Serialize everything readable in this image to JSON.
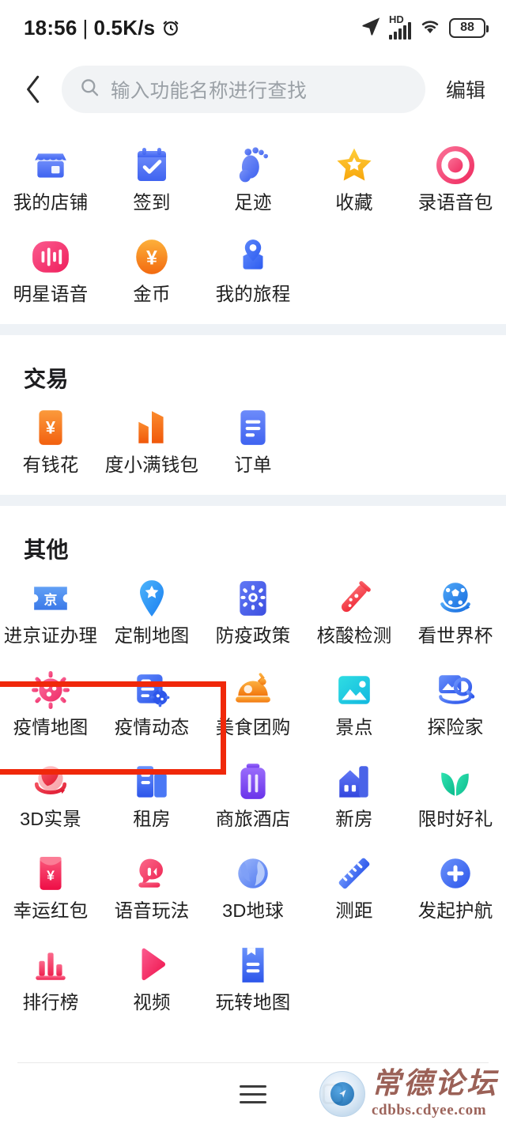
{
  "status_bar": {
    "time": "18:56",
    "separator": "|",
    "net_speed": "0.5K/s",
    "alarm_icon": "alarm-clock-icon",
    "location_icon": "location-arrow-icon",
    "hd_label": "HD",
    "signal_icon": "cellular-signal-icon",
    "wifi_icon": "wifi-icon",
    "battery_level": "88"
  },
  "header": {
    "back_icon": "chevron-left-icon",
    "search_placeholder": "输入功能名称进行查找",
    "search_value": "",
    "search_icon": "search-icon",
    "edit_label": "编辑"
  },
  "sections": [
    {
      "title": "",
      "items": [
        {
          "label": "我的店铺",
          "icon": "shop-icon",
          "color": "#5a7cf8"
        },
        {
          "label": "签到",
          "icon": "calendar-check-icon",
          "color": "#4c6ef5"
        },
        {
          "label": "足迹",
          "icon": "footprint-icon",
          "color": "#6d83f2"
        },
        {
          "label": "收藏",
          "icon": "star-icon",
          "color": "#fbb216"
        },
        {
          "label": "录语音包",
          "icon": "record-target-icon",
          "color": "#f2547d"
        },
        {
          "label": "明星语音",
          "icon": "voice-wave-icon",
          "color": "#f2376b"
        },
        {
          "label": "金币",
          "icon": "coin-yuan-icon",
          "color": "#f58220"
        },
        {
          "label": "我的旅程",
          "icon": "route-pin-icon",
          "color": "#3d72f7"
        }
      ]
    },
    {
      "title": "交易",
      "items": [
        {
          "label": "有钱花",
          "icon": "yuan-card-icon",
          "color": "#f5752a"
        },
        {
          "label": "度小满钱包",
          "icon": "wallet-icon",
          "color": "#f4701f"
        },
        {
          "label": "订单",
          "icon": "order-list-icon",
          "color": "#4c6ef5"
        }
      ]
    },
    {
      "title": "其他",
      "items": [
        {
          "label": "进京证办理",
          "icon": "jing-permit-icon",
          "color": "#4a8df0"
        },
        {
          "label": "定制地图",
          "icon": "map-pin-star-icon",
          "color": "#2e9bf5"
        },
        {
          "label": "防疫政策",
          "icon": "policy-gear-icon",
          "color": "#4a63e8"
        },
        {
          "label": "核酸检测",
          "icon": "test-tube-icon",
          "color": "#f2454c"
        },
        {
          "label": "看世界杯",
          "icon": "soccer-ball-icon",
          "color": "#2c8ef0"
        },
        {
          "label": "疫情地图",
          "icon": "virus-icon",
          "color": "#f2467a"
        },
        {
          "label": "疫情动态",
          "icon": "virus-report-icon",
          "color": "#3d6ef0"
        },
        {
          "label": "美食团购",
          "icon": "food-dome-icon",
          "color": "#f7931a"
        },
        {
          "label": "景点",
          "icon": "photo-mountain-icon",
          "color": "#1fc8dd"
        },
        {
          "label": "探险家",
          "icon": "explore-photo-search-icon",
          "color": "#3d72f7"
        },
        {
          "label": "3D实景",
          "icon": "3d-panorama-globe-icon",
          "color": "#ef3b4e"
        },
        {
          "label": "租房",
          "icon": "building-rent-icon",
          "color": "#3d72f7"
        },
        {
          "label": "商旅酒店",
          "icon": "suitcase-icon",
          "color": "#7b4ff0"
        },
        {
          "label": "新房",
          "icon": "new-house-icon",
          "color": "#4a63e8"
        },
        {
          "label": "限时好礼",
          "icon": "leaf-sprout-icon",
          "color": "#17cf9d"
        },
        {
          "label": "幸运红包",
          "icon": "red-envelope-icon",
          "color": "#f2325c"
        },
        {
          "label": "语音玩法",
          "icon": "speech-megaphone-icon",
          "color": "#f2466a"
        },
        {
          "label": "3D地球",
          "icon": "globe-3d-icon",
          "color": "#5b8def"
        },
        {
          "label": "测距",
          "icon": "ruler-icon",
          "color": "#4a74f0"
        },
        {
          "label": "发起护航",
          "icon": "plus-circle-icon",
          "color": "#3d72f7"
        },
        {
          "label": "排行榜",
          "icon": "bar-chart-rank-icon",
          "color": "#f2466a"
        },
        {
          "label": "视频",
          "icon": "play-triangle-icon",
          "color": "#f2325c"
        },
        {
          "label": "玩转地图",
          "icon": "map-book-icon",
          "color": "#3d72f7"
        }
      ]
    }
  ],
  "highlight": {
    "label": "疫情地图-疫情动态-highlight",
    "color": "#f0280a"
  },
  "bottom_nav": {
    "menu_icon": "hamburger-menu-icon",
    "home_icon": "square-home-icon"
  },
  "watermark": {
    "site_name": "常德论坛",
    "url": "cdbbs.cdyee.com"
  }
}
